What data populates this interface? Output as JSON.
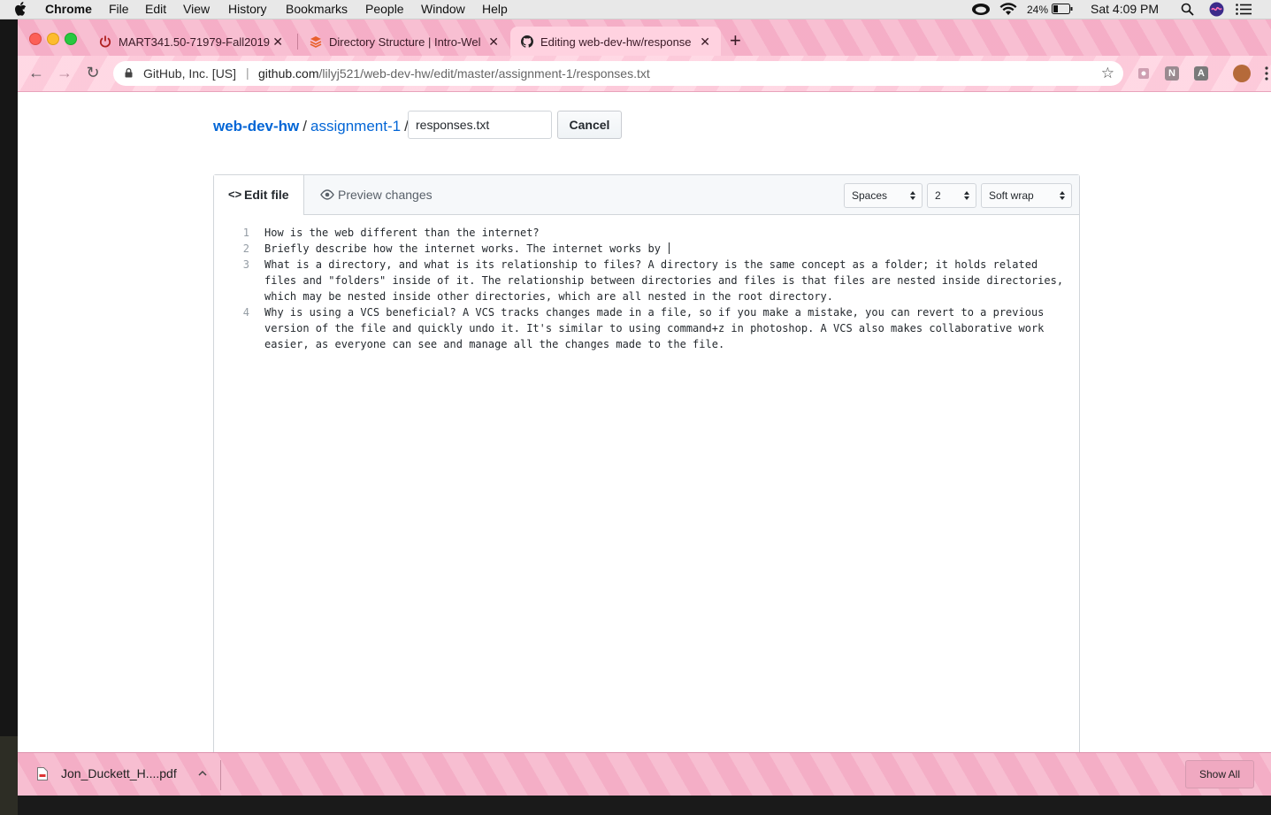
{
  "menubar": {
    "app": "Chrome",
    "items": [
      "File",
      "Edit",
      "View",
      "History",
      "Bookmarks",
      "People",
      "Window",
      "Help"
    ],
    "battery": "24%",
    "clock": "Sat 4:09 PM"
  },
  "tabs": [
    {
      "title": "MART341.50-71979-Fall2019:",
      "icon": "power-icon"
    },
    {
      "title": "Directory Structure | Intro-Wel",
      "icon": "stack-icon"
    },
    {
      "title": "Editing web-dev-hw/response",
      "icon": "github-icon",
      "active": true
    }
  ],
  "omnibox": {
    "org": "GitHub, Inc. [US]",
    "url_host": "github.com",
    "url_path": "/lilyj521/web-dev-hw/edit/master/assignment-1/responses.txt"
  },
  "extensions": [
    "N",
    "A"
  ],
  "breadcrumb": {
    "repo": "web-dev-hw",
    "dir": "assignment-1",
    "slash": "/"
  },
  "filename_input": {
    "value": "responses.txt"
  },
  "cancel_label": "Cancel",
  "editor": {
    "tab_edit": "Edit file",
    "tab_preview": "Preview changes",
    "indent_mode": "Spaces",
    "indent_size": "2",
    "wrap_mode": "Soft wrap",
    "lines": [
      {
        "n": "1",
        "text": "How is the web different than the internet?"
      },
      {
        "n": "2",
        "text": "Briefly describe how the internet works. The internet works by "
      },
      {
        "n": "3",
        "text": "What is a directory, and what is its relationship to files? A directory is the same concept as a folder; it holds related files and \"folders\" inside of it. The relationship between directories and files is that files are nested inside directories, which may be nested inside other directories, which are all nested in the root directory."
      },
      {
        "n": "4",
        "text": "Why is using a VCS beneficial? A VCS tracks changes made in a file, so if you make a mistake, you can revert to a previous version of the file and quickly undo it. It's similar to using command+z in photoshop. A VCS also makes collaborative work easier, as everyone can see and manage all the changes made to the file."
      }
    ]
  },
  "downloads": {
    "file": "Jon_Duckett_H....pdf",
    "show_all": "Show All"
  },
  "colors": {
    "chrome_theme": "#f7b6cc",
    "link": "#0366d6"
  }
}
